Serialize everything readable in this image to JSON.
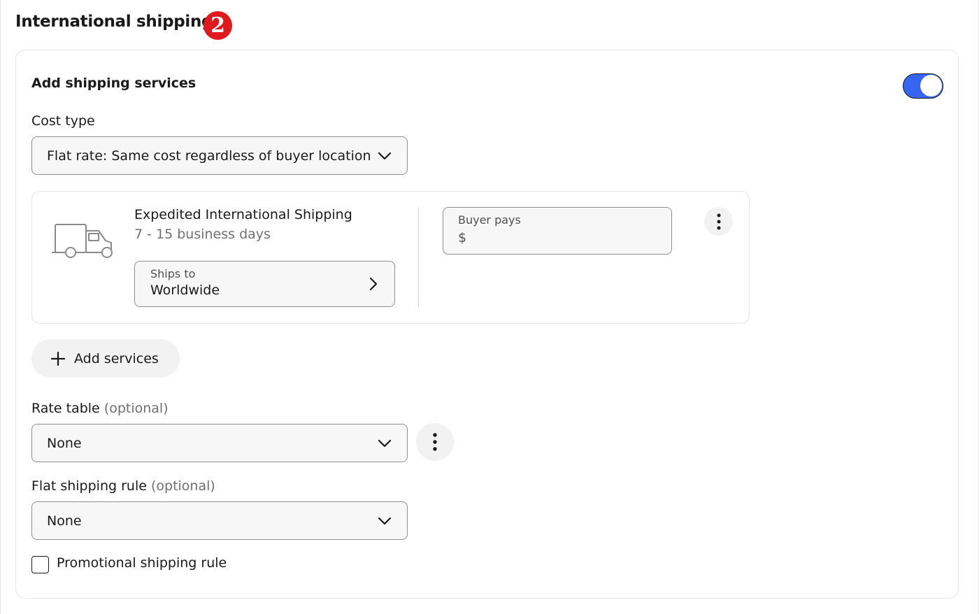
{
  "section": {
    "title": "International shipping",
    "step_badge": "2"
  },
  "add_shipping_services": {
    "title": "Add shipping services",
    "toggle_on": true,
    "toggle_color": "#3665f3"
  },
  "cost_type": {
    "label": "Cost type",
    "selected": "Flat rate: Same cost regardless of buyer location"
  },
  "service": {
    "icon": "truck-icon",
    "name": "Expedited International Shipping",
    "days": "7 - 15 business days",
    "ships_to_label": "Ships to",
    "ships_to_value": "Worldwide",
    "buyer_pays_label": "Buyer pays",
    "buyer_pays_currency": "$",
    "buyer_pays_value": ""
  },
  "add_services_button": {
    "label": "Add services",
    "icon": "plus-icon"
  },
  "rate_table": {
    "label": "Rate table",
    "optional": "(optional)",
    "selected": "None"
  },
  "flat_shipping_rule": {
    "label": "Flat shipping rule",
    "optional": "(optional)",
    "selected": "None"
  },
  "promotional_rule": {
    "label": "Promotional shipping rule",
    "checked": false
  },
  "colors": {
    "accent": "#3665f3",
    "badge": "#e0191f"
  }
}
